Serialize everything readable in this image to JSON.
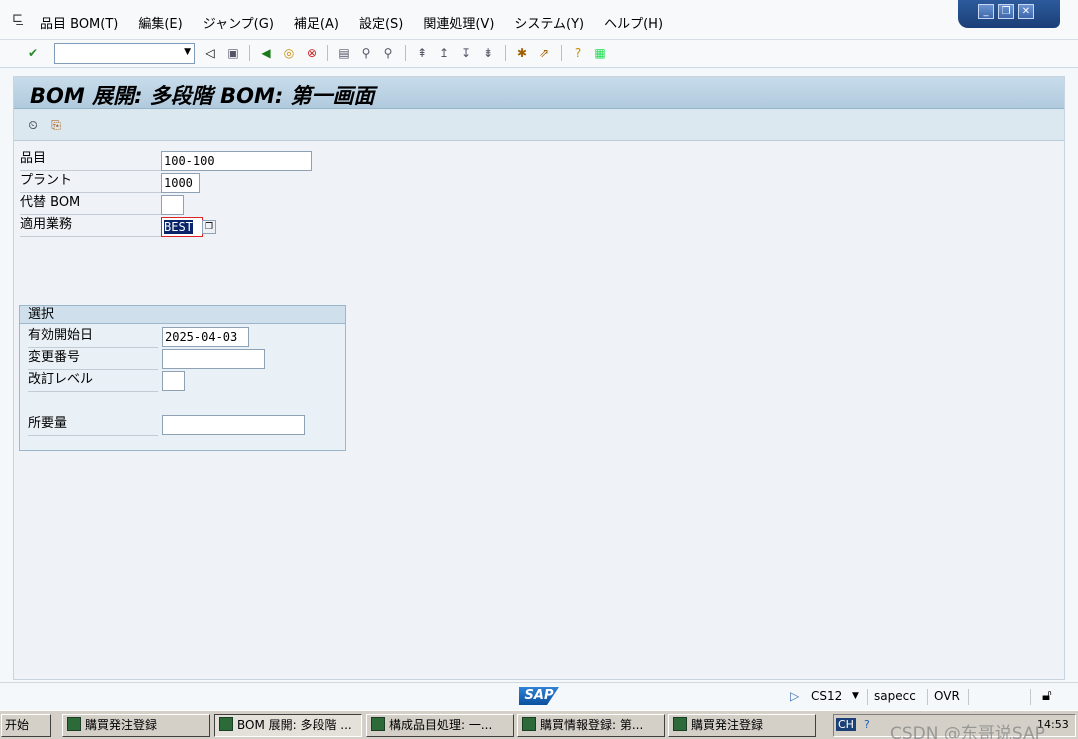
{
  "menu": {
    "items": [
      "品目 BOM(T)",
      "編集(E)",
      "ジャンプ(G)",
      "補足(A)",
      "設定(S)",
      "関連処理(V)",
      "システム(Y)",
      "ヘルプ(H)"
    ]
  },
  "window_controls": {
    "minimize": "_",
    "restore": "❐",
    "close": "✕"
  },
  "toolbar": {
    "okcode_value": ""
  },
  "screen": {
    "title": "BOM 展開: 多段階 BOM: 第一画面"
  },
  "fields": {
    "material": {
      "label": "品目",
      "value": "100-100"
    },
    "plant": {
      "label": "プラント",
      "value": "1000"
    },
    "alt_bom": {
      "label": "代替 BOM",
      "value": ""
    },
    "bom_app": {
      "label": "適用業務",
      "value": "BEST"
    }
  },
  "selection": {
    "title": "選択",
    "valid_from": {
      "label": "有効開始日",
      "value": "2025-04-03"
    },
    "change_number": {
      "label": "変更番号",
      "value": ""
    },
    "revision_level": {
      "label": "改訂レベル",
      "value": ""
    },
    "required_qty": {
      "label": "所要量",
      "value": ""
    }
  },
  "status": {
    "logo": "SAP",
    "transaction": "CS12",
    "server": "sapecc",
    "mode": "OVR"
  },
  "taskbar": {
    "start": "开始",
    "tasks": [
      "購買発注登録",
      "BOM 展開: 多段階 ...",
      "構成品目処理: 一...",
      "購買情報登録: 第...",
      "購買発注登録"
    ],
    "tray": {
      "lang": "CH",
      "clock": "14:53"
    },
    "watermark": "CSDN @东哥说SAP"
  }
}
